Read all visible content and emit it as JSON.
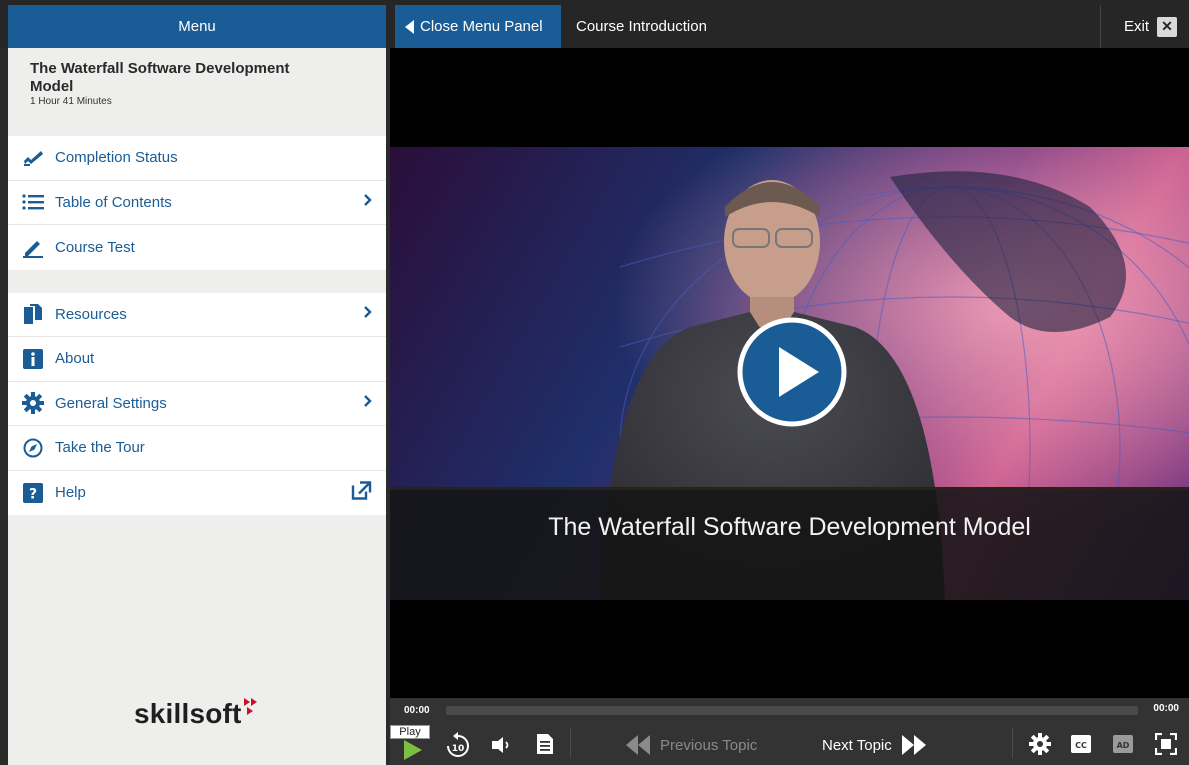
{
  "header": {
    "menu_label": "Menu",
    "close_panel_label": "Close Menu Panel",
    "course_section": "Course Introduction",
    "exit_label": "Exit"
  },
  "course": {
    "title": "The Waterfall Software Development Model",
    "duration": "1 Hour 41 Minutes"
  },
  "menu_group_1": [
    {
      "label": "Completion Status",
      "icon": "completion-icon",
      "has_chevron": false
    },
    {
      "label": "Table of Contents",
      "icon": "list-icon",
      "has_chevron": true
    },
    {
      "label": "Course Test",
      "icon": "pencil-icon",
      "has_chevron": false
    }
  ],
  "menu_group_2": [
    {
      "label": "Resources",
      "icon": "documents-icon",
      "has_chevron": true
    },
    {
      "label": "About",
      "icon": "info-icon",
      "has_chevron": false
    },
    {
      "label": "General Settings",
      "icon": "gear-icon",
      "has_chevron": true
    },
    {
      "label": "Take the Tour",
      "icon": "compass-icon",
      "has_chevron": false
    },
    {
      "label": "Help",
      "icon": "help-icon",
      "external_icon": "external-link-icon"
    }
  ],
  "logo": {
    "text": "skillsoft"
  },
  "video": {
    "lower_third_title": "The Waterfall Software Development Model",
    "state": "paused"
  },
  "player": {
    "current_time": "00:00",
    "duration": "00:00",
    "progress": 0,
    "play_tooltip": "Play",
    "prev_topic": "Previous Topic",
    "next_topic": "Next Topic",
    "rewind_seconds": "10",
    "cc_label": "CC",
    "ad_label": "AD"
  },
  "colors": {
    "accent_blue": "#1a5c96",
    "play_green": "#7bc043",
    "gold": "#b68d2f",
    "logo_red": "#c8102e"
  }
}
